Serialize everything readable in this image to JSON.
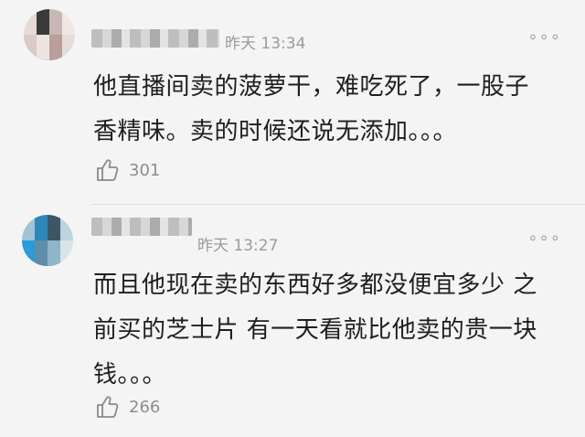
{
  "comments": [
    {
      "time": "昨天 13:34",
      "more": "∘∘∘",
      "text": "他直播间卖的菠萝干，难吃死了，一股子香精味。卖的时候还说无添加。。。",
      "likes": "301",
      "like_icon": "thumbs-up-icon"
    },
    {
      "time": "昨天 13:27",
      "more": "∘∘∘",
      "text": "而且他现在卖的东西好多都没便宜多少 之前买的芝士片 有一天看就比他卖的贵一块钱。。。",
      "likes": "266",
      "like_icon": "thumbs-up-icon"
    }
  ]
}
